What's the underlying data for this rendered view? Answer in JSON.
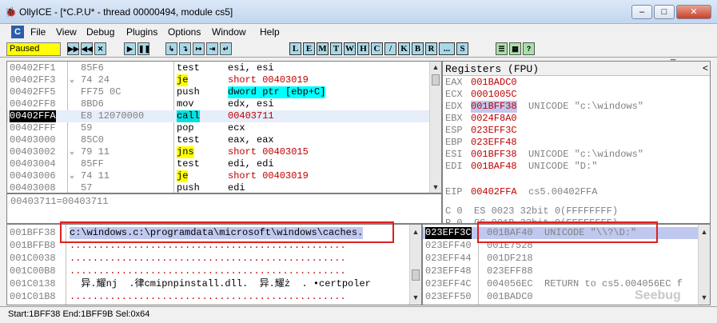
{
  "window": {
    "title": "OllyICE - [*C.P.U* - thread 00000494, module cs5]",
    "min": "–",
    "max": "□",
    "close": "✕"
  },
  "menu": [
    "File",
    "View",
    "Debug",
    "Plugins",
    "Options",
    "Window",
    "Help"
  ],
  "mdi": {
    "min": "_",
    "restore": "▫",
    "close": "×"
  },
  "state": "Paused",
  "toolbar_groups": [
    "▶▶",
    "◀◀",
    "✕",
    "▶",
    "❚❚",
    "↳",
    "↴",
    "↦",
    "⇥",
    "↵"
  ],
  "toolbar_letters": [
    "L",
    "E",
    "M",
    "T",
    "W",
    "H",
    "C",
    "/",
    "K",
    "B",
    "R",
    "...",
    "S"
  ],
  "disasm": [
    {
      "addr": "00402FF1",
      "mark": " ",
      "hex": "85F6",
      "mn": "test",
      "ops": "esi, esi",
      "mncls": "",
      "opcls": ""
    },
    {
      "addr": "00402FF3",
      "mark": "⌄",
      "hex": "74 24",
      "mn": "je",
      "ops": "short 00403019",
      "mncls": "hl-yellow",
      "opcls": "red"
    },
    {
      "addr": "00402FF5",
      "mark": " ",
      "hex": "FF75 0C",
      "mn": "push",
      "ops": "dword ptr [ebp+C]",
      "mncls": "",
      "opcls": "hl-cyan"
    },
    {
      "addr": "00402FF8",
      "mark": " ",
      "hex": "8BD6",
      "mn": "mov",
      "ops": "edx, esi",
      "mncls": "",
      "opcls": ""
    },
    {
      "addr": "00402FFA",
      "mark": " ",
      "hex": "E8 12070000",
      "mn": "call",
      "ops": "00403711",
      "mncls": "",
      "opcls": ""
    },
    {
      "addr": "00402FFF",
      "mark": " ",
      "hex": "59",
      "mn": "pop",
      "ops": "ecx",
      "mncls": "",
      "opcls": ""
    },
    {
      "addr": "00403000",
      "mark": " ",
      "hex": "85C0",
      "mn": "test",
      "ops": "eax, eax",
      "mncls": "",
      "opcls": ""
    },
    {
      "addr": "00403002",
      "mark": "⌄",
      "hex": "79 11",
      "mn": "jns",
      "ops": "short 00403015",
      "mncls": "hl-yellow",
      "opcls": "red"
    },
    {
      "addr": "00403004",
      "mark": " ",
      "hex": "85FF",
      "mn": "test",
      "ops": "edi, edi",
      "mncls": "",
      "opcls": ""
    },
    {
      "addr": "00403006",
      "mark": "⌄",
      "hex": "74 11",
      "mn": "je",
      "ops": "short 00403019",
      "mncls": "hl-yellow",
      "opcls": "red"
    },
    {
      "addr": "00403008",
      "mark": " ",
      "hex": "57",
      "mn": "push",
      "ops": "edi",
      "mncls": "",
      "opcls": ""
    }
  ],
  "info_line": "00403711=00403711",
  "registers": {
    "header": "Registers (FPU)",
    "rows": [
      {
        "name": "EAX",
        "val": "001BADC0",
        "cmt": ""
      },
      {
        "name": "ECX",
        "val": "0001005C",
        "cmt": ""
      },
      {
        "name": "EDX",
        "val": "001BFF38",
        "cmt": "UNICODE \"c:\\windows\""
      },
      {
        "name": "EBX",
        "val": "0024F8A0",
        "cmt": ""
      },
      {
        "name": "ESP",
        "val": "023EFF3C",
        "cmt": ""
      },
      {
        "name": "EBP",
        "val": "023EFF48",
        "cmt": ""
      },
      {
        "name": "ESI",
        "val": "001BFF38",
        "cmt": "UNICODE \"c:\\windows\""
      },
      {
        "name": "EDI",
        "val": "001BAF48",
        "cmt": "UNICODE \"D:\""
      }
    ],
    "eip": {
      "name": "EIP",
      "val": "00402FFA",
      "cmt": "cs5.00402FFA"
    },
    "flags": [
      "C 0  ES 0023 32bit 0(FFFFFFFF)",
      "P 0  CS 001B 32bit 0(FFFFFFFF)"
    ]
  },
  "dump": [
    {
      "addr": "001BFF38",
      "text": "c:\\windows.c:\\programdata\\microsoft\\windows\\caches."
    },
    {
      "addr": "001BFFB8",
      "text": "................................................"
    },
    {
      "addr": "001C0038",
      "text": "................................................"
    },
    {
      "addr": "001C00B8",
      "text": "................................................"
    },
    {
      "addr": "001C0138",
      "text": "  异.耀nj  .律cmipnpinstall.dll.  异.耀ż  . •certpoler"
    },
    {
      "addr": "001C01B8",
      "text": "................................................"
    }
  ],
  "stack": [
    {
      "addr": "023EFF3C",
      "val": "001BAF40",
      "cmt": "UNICODE \"\\\\?\\D:\""
    },
    {
      "addr": "023EFF40",
      "val": "001E7528",
      "cmt": ""
    },
    {
      "addr": "023EFF44",
      "val": "001DF218",
      "cmt": ""
    },
    {
      "addr": "023EFF48",
      "val": "023EFF88",
      "cmt": ""
    },
    {
      "addr": "023EFF4C",
      "val": "004056EC",
      "cmt": "RETURN to cs5.004056EC f"
    },
    {
      "addr": "023EFF50",
      "val": "001BADC0",
      "cmt": ""
    }
  ],
  "statusbar": "Start:1BFF38 End:1BFF9B Sel:0x64",
  "watermark": "Seebug"
}
